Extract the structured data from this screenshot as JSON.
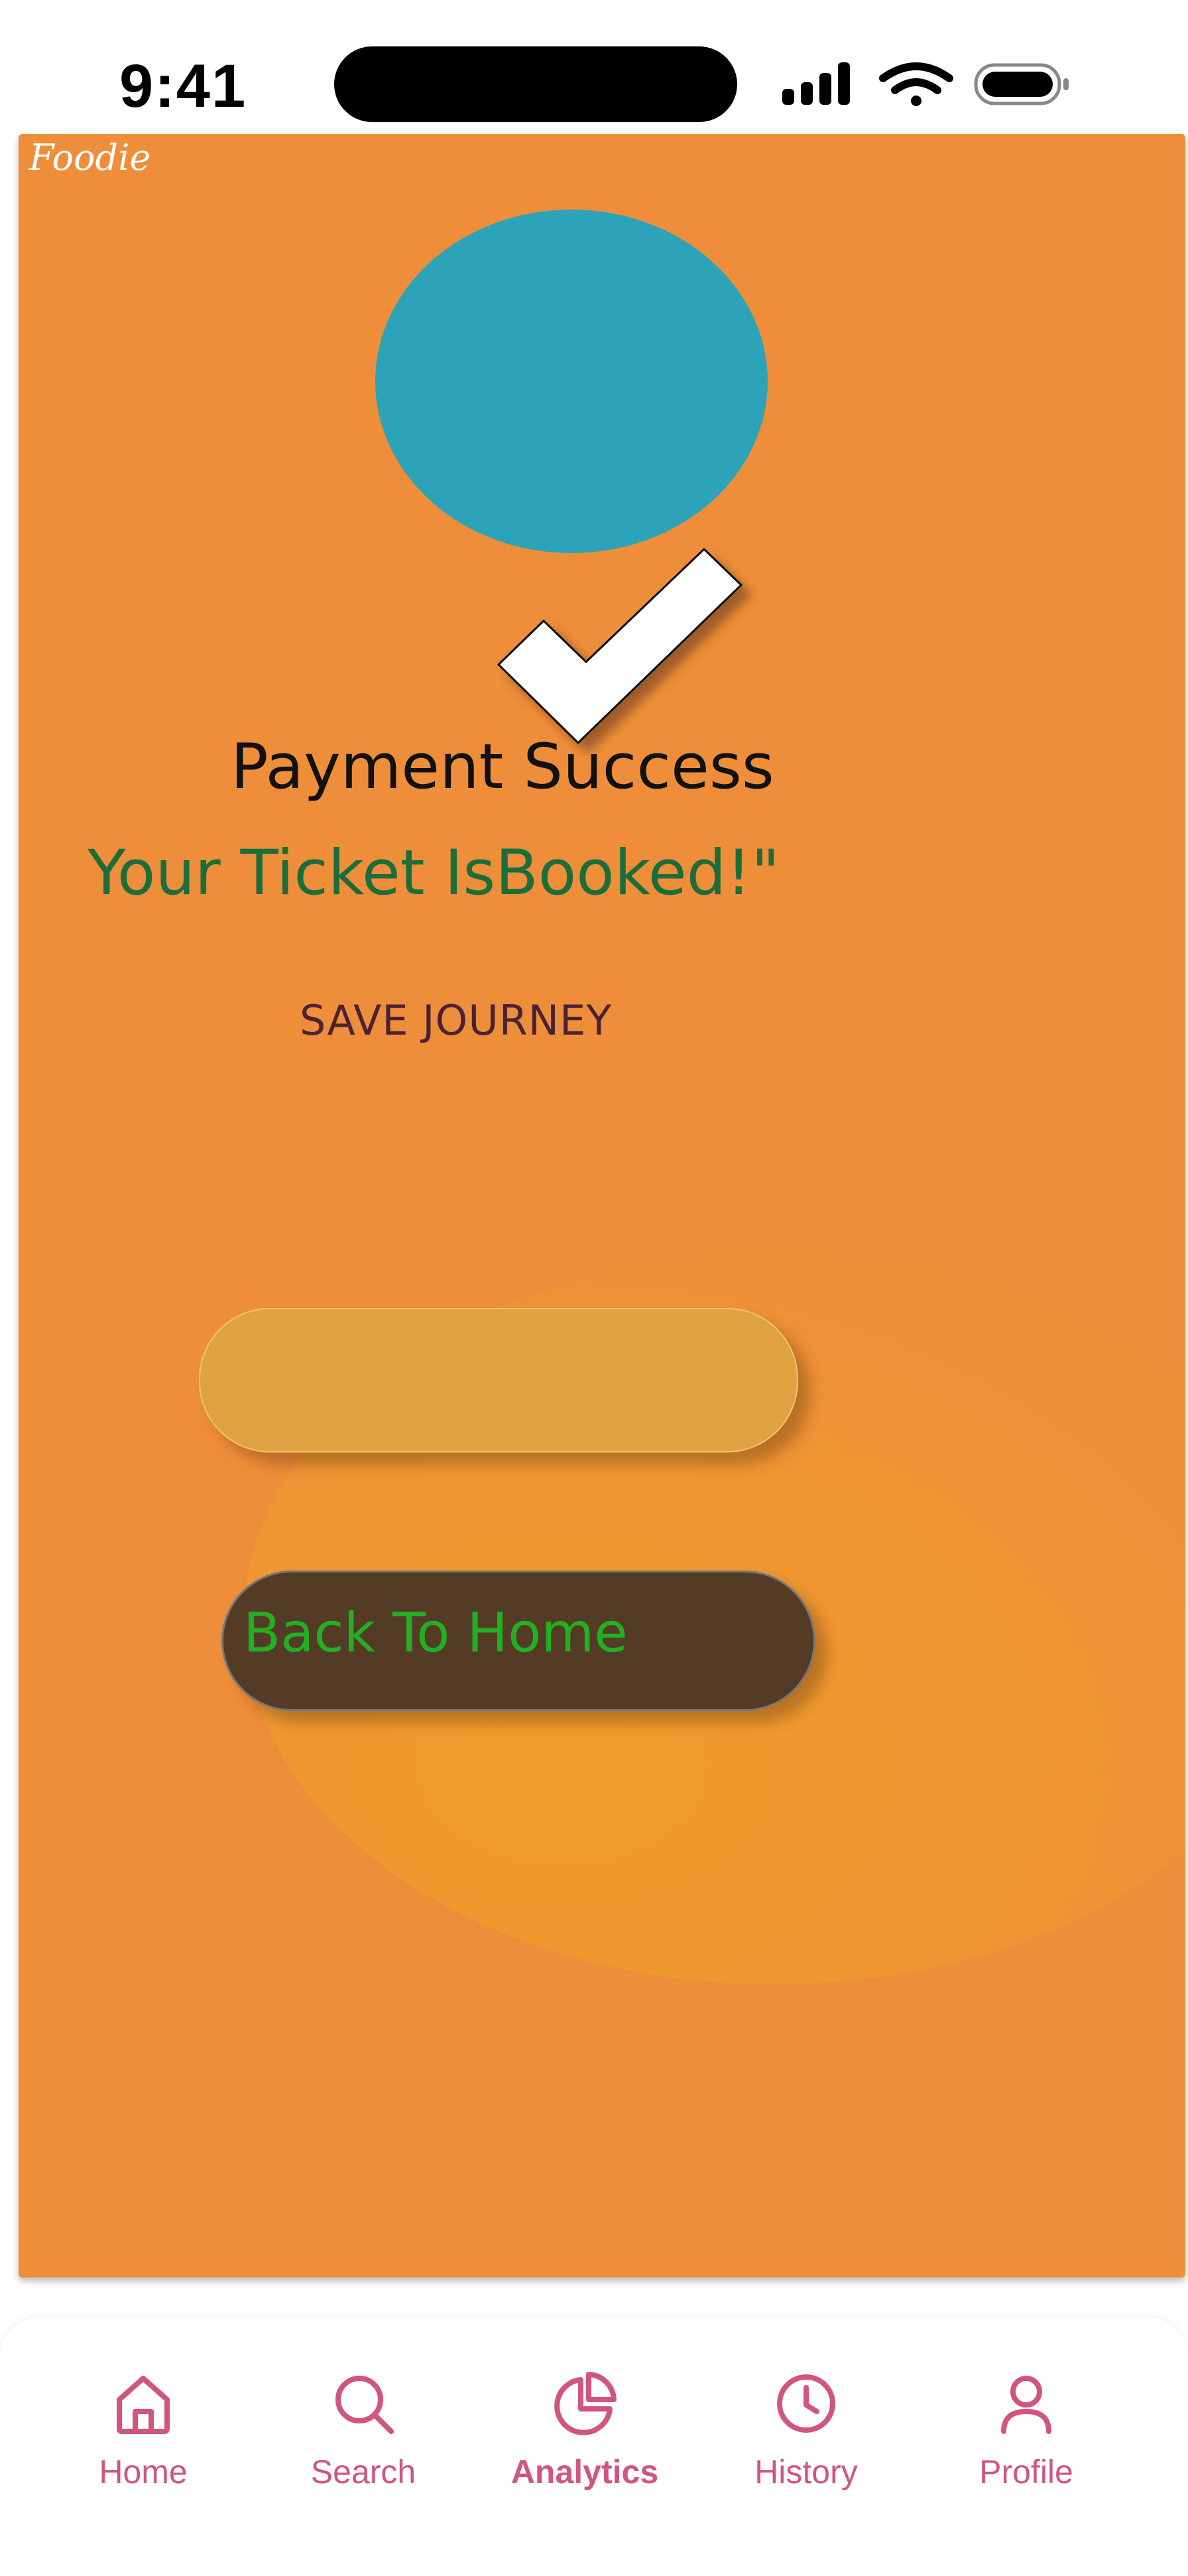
{
  "status_bar": {
    "time": "9:41"
  },
  "header": {
    "brand": "Foodie"
  },
  "payment": {
    "title": "Payment Success",
    "subtitle": "Your Ticket IsBooked!\"",
    "save_link": "SAVE JOURNEY",
    "primary_button_label": "",
    "back_button_label": "Back To Home"
  },
  "colors": {
    "panel": "#EF8E3A",
    "circle": "#2CA3B8",
    "subtitle": "#1B6D3B",
    "back_button_bg": "#543B25",
    "back_button_text": "#22B022",
    "tab_accent": "#D1557E"
  },
  "tabbar": {
    "items": [
      {
        "label": "Home",
        "icon": "home-icon"
      },
      {
        "label": "Search",
        "icon": "search-icon"
      },
      {
        "label": "Analytics",
        "icon": "pie-chart-icon",
        "active": true
      },
      {
        "label": "History",
        "icon": "clock-icon"
      },
      {
        "label": "Profile",
        "icon": "user-icon"
      }
    ]
  }
}
